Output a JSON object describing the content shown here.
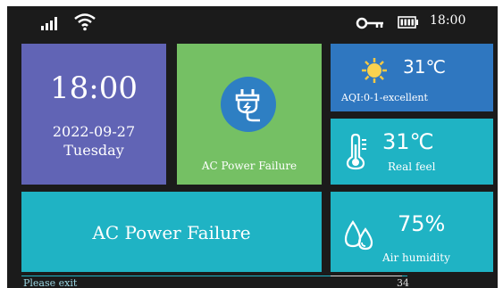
{
  "status_bar": {
    "time": "18:00",
    "icons": [
      "signal-icon",
      "wifi-icon",
      "key-icon",
      "battery-icon"
    ]
  },
  "clock_tile": {
    "time": "18:00",
    "date": "2022-09-27",
    "weekday": "Tuesday",
    "color": "#6164b5"
  },
  "ac_tile": {
    "label": "AC Power Failure",
    "icon": "plug-icon",
    "color": "#75c064"
  },
  "weather_tile": {
    "temperature": "31℃",
    "aqi": "AQI:0-1-excellent",
    "icon": "sun-icon",
    "color": "#2f77c0"
  },
  "real_feel_tile": {
    "temperature": "31℃",
    "label": "Real feel",
    "icon": "thermometer-icon"
  },
  "alarm_tile": {
    "text": "AC Power Failure",
    "color": "#1fb3c4"
  },
  "humidity_tile": {
    "value": "75%",
    "label": "Air humidity",
    "icon": "water-drops-icon"
  },
  "footer": {
    "hint": "Please exit",
    "countdown": "34"
  }
}
